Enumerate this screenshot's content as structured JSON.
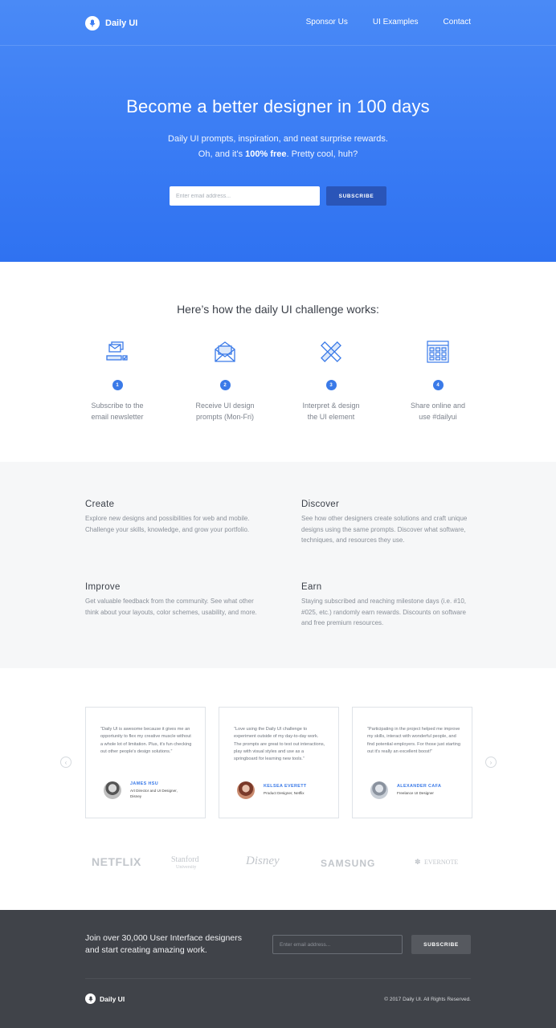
{
  "brand": {
    "name": "Daily UI"
  },
  "nav": {
    "links": [
      "Sponsor Us",
      "UI Examples",
      "Contact"
    ]
  },
  "hero": {
    "title": "Become a better designer in 100 days",
    "subtitle_line1": "Daily UI prompts, inspiration, and neat surprise rewards.",
    "subtitle_line2_prefix": "Oh, and it's ",
    "subtitle_line2_bold": "100% free",
    "subtitle_line2_suffix": ". Pretty cool, huh?",
    "email_placeholder": "Enter email address...",
    "subscribe_label": "SUBSCRIBE"
  },
  "how": {
    "title": "Here’s how the daily UI challenge works:",
    "steps": [
      {
        "num": "1",
        "line1": "Subscribe to the",
        "line2": "email newsletter",
        "icon": "newsletter-icon"
      },
      {
        "num": "2",
        "line1": "Receive UI design",
        "line2": "prompts (Mon-Fri)",
        "icon": "open-envelope-icon"
      },
      {
        "num": "3",
        "line1": "Interpret & design",
        "line2": "the UI element",
        "icon": "pencil-ruler-icon"
      },
      {
        "num": "4",
        "line1": "Share online and",
        "line2": "use #dailyui",
        "icon": "grid-layout-icon"
      }
    ]
  },
  "features": [
    {
      "title": "Create",
      "text": "Explore new designs and possibilities for web and mobile. Challenge your skills, knowledge, and grow your portfolio."
    },
    {
      "title": "Discover",
      "text": "See how other designers create solutions and craft unique designs using the same prompts. Discover what software, techniques, and resources they use."
    },
    {
      "title": "Improve",
      "text": "Get valuable feedback from the community. See what other think about your layouts, color schemes, usability, and more."
    },
    {
      "title": "Earn",
      "text": "Staying subscribed and reaching milestone days (i.e. #10, #025, etc.) randomly earn rewards. Discounts on software and free premium resources."
    }
  ],
  "testimonials": [
    {
      "quote": "“Daily UI is awesome because it gives me an opportunity to flex my creative muscle without a whole lot of limitation. Plus, it's fun checking out other people's design solutions.”",
      "name": "JAMES HSU",
      "role": "Art Director and UI Designer, Disney"
    },
    {
      "quote": "“Love using the Daily UI challenge to experiment outside of my day-to-day work. The prompts are great to test out interactions, play with visual styles and use as a springboard for learning new tools.”",
      "name": "KELSEA EVERETT",
      "role": "Product Designer, Netflix"
    },
    {
      "quote": "“Participating in the project helped me improve my skills, interact with wonderful people, and find potential employers. For those just starting out it's really an excellent boost!”",
      "name": "ALEXANDER CAFA",
      "role": "Freelance UI Designer"
    }
  ],
  "logos": [
    "NETFLIX",
    "Stanford",
    "University",
    "Disney",
    "SAMSUNG",
    "EVERNOTE"
  ],
  "footer": {
    "cta_line1": "Join over 30,000 User Interface designers",
    "cta_line2": "and start creating amazing work.",
    "email_placeholder": "Enter email address...",
    "subscribe_label": "SUBSCRIBE",
    "brand": "Daily UI",
    "copyright": "© 2017 Daily UI. All Rights Reserved."
  },
  "colors": {
    "hero_blue": "#3a7cf4",
    "button_dark_blue": "#2a55b8",
    "accent_blue": "#3a7ae8",
    "footer_bg": "#404349"
  }
}
